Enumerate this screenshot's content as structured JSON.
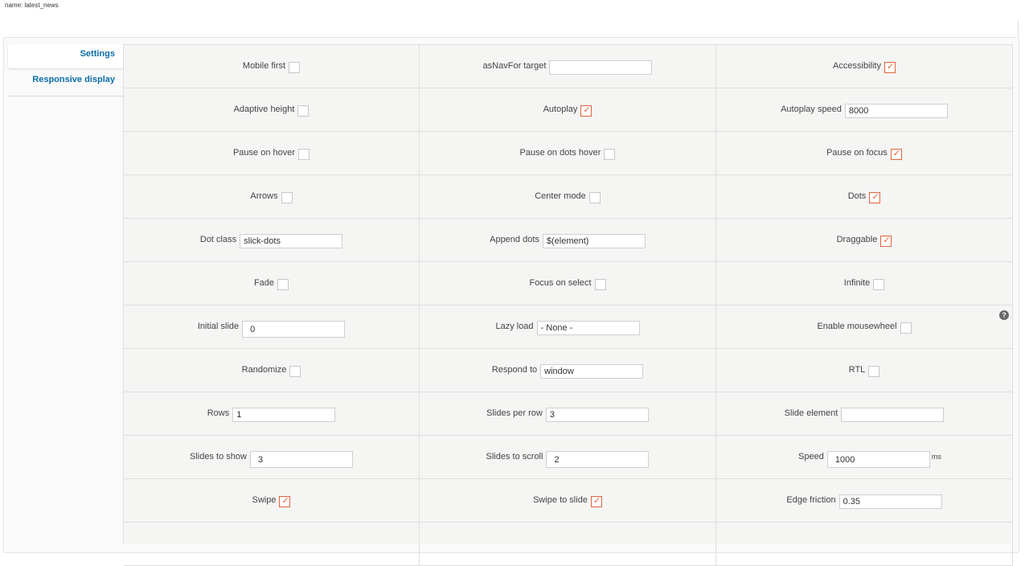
{
  "header": {
    "name_line": "name: latest_news"
  },
  "tabs": [
    {
      "label": "Settings",
      "active": true
    },
    {
      "label": "Responsive display",
      "active": false
    }
  ],
  "colors": {
    "accent": "#e0643a",
    "link": "#0a6ea8"
  },
  "fields": {
    "mobile_first": {
      "label": "Mobile first",
      "checked": false
    },
    "as_nav_for": {
      "label": "asNavFor target",
      "value": ""
    },
    "accessibility": {
      "label": "Accessibility",
      "checked": true
    },
    "adaptive_height": {
      "label": "Adaptive height",
      "checked": false
    },
    "autoplay": {
      "label": "Autoplay",
      "checked": true
    },
    "autoplay_speed": {
      "label": "Autoplay speed",
      "value": "8000"
    },
    "pause_on_hover": {
      "label": "Pause on hover",
      "checked": false
    },
    "pause_on_dots_hover": {
      "label": "Pause on dots hover",
      "checked": false
    },
    "pause_on_focus": {
      "label": "Pause on focus",
      "checked": true
    },
    "arrows": {
      "label": "Arrows",
      "checked": false
    },
    "center_mode": {
      "label": "Center mode",
      "checked": false
    },
    "dots": {
      "label": "Dots",
      "checked": true
    },
    "dot_class": {
      "label": "Dot class",
      "value": "slick-dots"
    },
    "append_dots": {
      "label": "Append dots",
      "value": "$(element)"
    },
    "draggable": {
      "label": "Draggable",
      "checked": true
    },
    "fade": {
      "label": "Fade",
      "checked": false
    },
    "focus_on_select": {
      "label": "Focus on select",
      "checked": false
    },
    "infinite": {
      "label": "Infinite",
      "checked": false
    },
    "initial_slide": {
      "label": "Initial slide",
      "value": "0"
    },
    "lazy_load": {
      "label": "Lazy load",
      "value": "- None -"
    },
    "enable_mousewheel": {
      "label": "Enable mousewheel",
      "checked": false,
      "help": "?"
    },
    "randomize": {
      "label": "Randomize",
      "checked": false
    },
    "respond_to": {
      "label": "Respond to",
      "value": "window"
    },
    "rtl": {
      "label": "RTL",
      "checked": false
    },
    "rows": {
      "label": "Rows",
      "value": "1"
    },
    "slides_per_row": {
      "label": "Slides per row",
      "value": "3"
    },
    "slide_element": {
      "label": "Slide element",
      "value": ""
    },
    "slides_to_show": {
      "label": "Slides to show",
      "value": "3"
    },
    "slides_to_scroll": {
      "label": "Slides to scroll",
      "value": "2"
    },
    "speed": {
      "label": "Speed",
      "value": "1000",
      "unit": "ms"
    },
    "swipe": {
      "label": "Swipe",
      "checked": true
    },
    "swipe_to_slide": {
      "label": "Swipe to slide",
      "checked": true
    },
    "edge_friction": {
      "label": "Edge friction",
      "value": "0.35"
    }
  }
}
